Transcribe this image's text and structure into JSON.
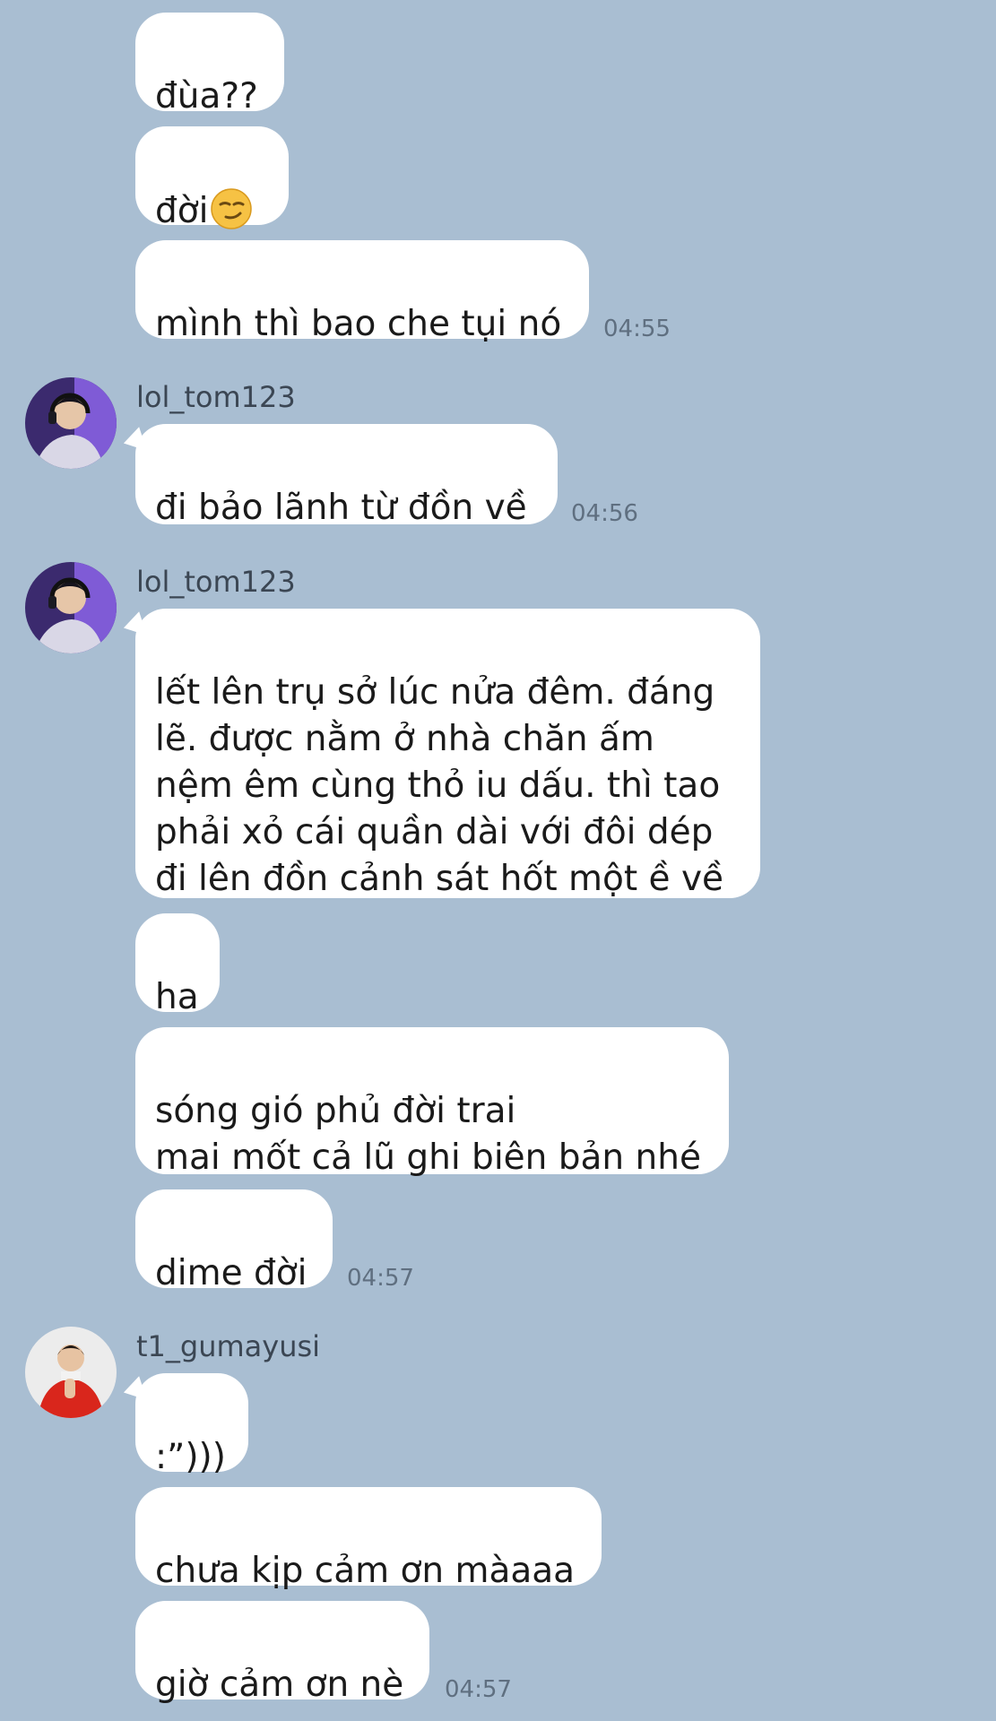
{
  "messages": [
    {
      "text": "đùa??"
    },
    {
      "text": "đời",
      "emoji": "smirking-face-emoji"
    },
    {
      "text": "mình thì bao che tụi nó",
      "time": "04:55"
    },
    {
      "sender": "lol_tom123",
      "text": "đi bảo lãnh từ đồn về",
      "time": "04:56"
    },
    {
      "sender": "lol_tom123",
      "text": "lết lên trụ sở lúc nửa đêm. đáng\nlẽ. được nằm ở nhà chăn ấm\nnệm êm cùng thỏ iu dấu. thì tao\nphải xỏ cái quần dài với đôi dép\nđi lên đồn cảnh sát hốt một ề về"
    },
    {
      "text": "ha"
    },
    {
      "text": "sóng gió phủ đời trai\nmai mốt cả lũ ghi biên bản nhé"
    },
    {
      "text": "dime đời",
      "time": "04:57"
    },
    {
      "sender": "t1_gumayusi",
      "text": ":”)))"
    },
    {
      "text": "chưa kịp cảm ơn màaaa"
    },
    {
      "text": "giờ cảm ơn nè",
      "time": "04:57"
    }
  ],
  "colors": {
    "background": "#a9bed2",
    "bubble": "#ffffff",
    "time": "#5f6f80"
  },
  "avatars": {
    "lol_tom123": "headset-player-avatar",
    "t1_gumayusi": "red-jacket-player-avatar"
  }
}
